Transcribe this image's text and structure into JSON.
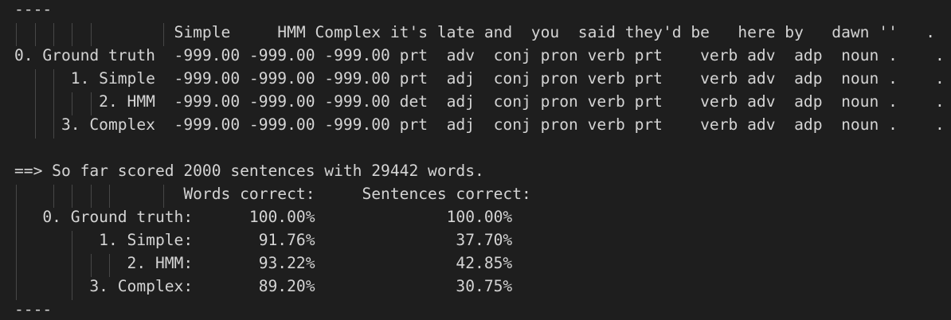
{
  "terminal": {
    "lines": [
      "----",
      "                 Simple     HMM Complex it's late and  you  said they'd be   here by   dawn ''   .",
      "0. Ground truth  -999.00 -999.00 -999.00 prt  adv  conj pron verb prt    verb adv  adp  noun .    .",
      "      1. Simple  -999.00 -999.00 -999.00 prt  adj  conj pron verb prt    verb adv  adp  noun .    .",
      "         2. HMM  -999.00 -999.00 -999.00 det  adj  conj pron verb prt    verb adv  adp  noun .    .",
      "     3. Complex  -999.00 -999.00 -999.00 prt  adj  conj pron verb prt    verb adv  adp  noun .    .",
      "",
      "==> So far scored 2000 sentences with 29442 words.",
      "                  Words correct:     Sentences correct:",
      "   0. Ground truth:      100.00%              100.00%",
      "         1. Simple:       91.76%               37.70%",
      "            2. HMM:       93.22%               42.85%",
      "        3. Complex:       89.20%               30.75%",
      "----"
    ]
  }
}
